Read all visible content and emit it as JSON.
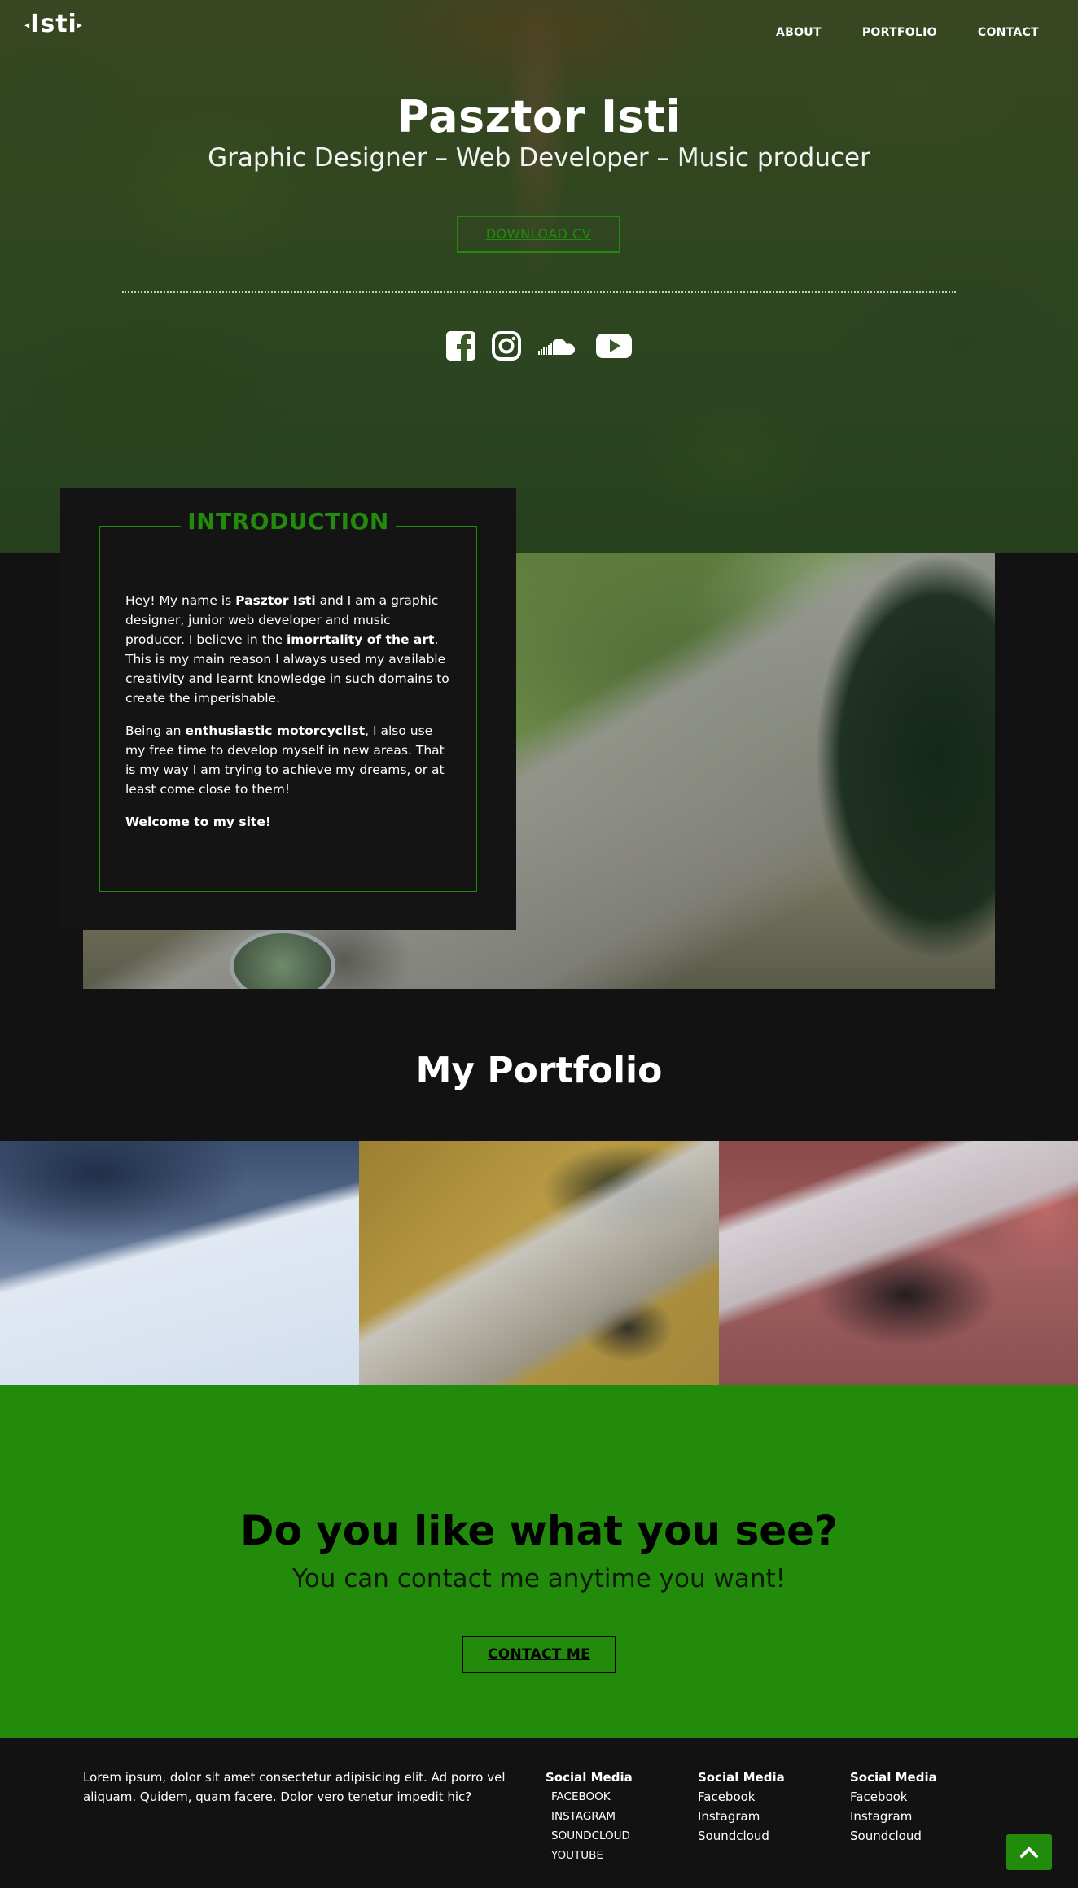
{
  "nav": {
    "logo": "Isti",
    "items": [
      "ABOUT",
      "PORTFOLIO",
      "CONTACT"
    ]
  },
  "hero": {
    "title": "Pasztor Isti",
    "subtitle": "Graphic Designer – Web Developer – Music producer",
    "cv_button": "DOWNLOAD CV",
    "social_icons": [
      "facebook-icon",
      "instagram-icon",
      "soundcloud-icon",
      "youtube-icon"
    ]
  },
  "intro": {
    "heading": "INTRODUCTION",
    "p1_a": "Hey! My name is ",
    "p1_b": "Pasztor Isti",
    "p1_c": " and I am a graphic designer, junior web developer and music producer. I believe in the ",
    "p1_d": "imorrtality of the art",
    "p1_e": ". This is my main reason I always used my available creativity and learnt knowledge in such domains to create the imperishable.",
    "p2_a": "Being an ",
    "p2_b": "enthusiastic motorcyclist",
    "p2_c": ", I also use my free time to develop myself in new areas. That is my way I am trying to achieve my dreams, or at least come close to them!",
    "p3": "Welcome to my site!"
  },
  "portfolio": {
    "title": "My Portfolio"
  },
  "cta": {
    "title": "Do you like what you see?",
    "subtitle": "You can contact me anytime you want!",
    "button": "CONTACT ME"
  },
  "footer": {
    "about": "Lorem ipsum, dolor sit amet consectetur adipisicing elit. Ad porro vel aliquam. Quidem, quam facere. Dolor vero tenetur impedit hic?",
    "col1": {
      "heading": "Social Media",
      "links": [
        "FACEBOOK",
        "INSTAGRAM",
        "SOUNDCLOUD",
        "YOUTUBE"
      ]
    },
    "col2": {
      "heading": "Social Media",
      "links": [
        "Facebook",
        "Instagram",
        "Soundcloud"
      ]
    },
    "col3": {
      "heading": "Social Media",
      "links": [
        "Facebook",
        "Instagram",
        "Soundcloud"
      ]
    }
  },
  "colors": {
    "accent": "#228b0c",
    "background": "#121212",
    "card": "#141414"
  }
}
